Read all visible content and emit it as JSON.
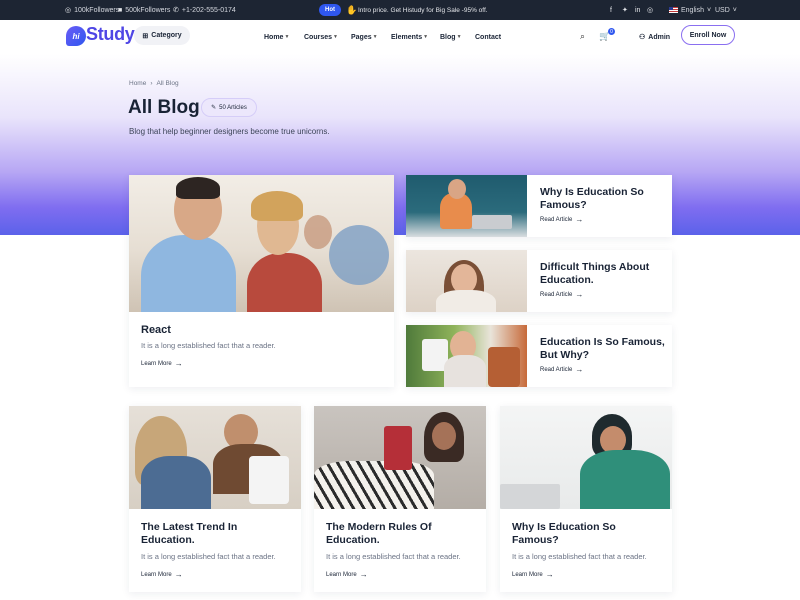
{
  "topbar": {
    "instagram_followers": "100kFollowers",
    "facebook_followers": "500kFollowers",
    "phone": "+1-202-555-0174",
    "hot_badge": "Hot",
    "promo_text": "Intro price. Get Histudy for Big Sale -95% off.",
    "language": "English",
    "currency": "USD"
  },
  "header": {
    "logo_mark": "hi",
    "logo_text": "Study",
    "category_label": "Category",
    "nav": [
      "Home",
      "Courses",
      "Pages",
      "Elements",
      "Blog",
      "Contact"
    ],
    "cart_count": "0",
    "admin_label": "Admin",
    "enroll_label": "Enroll Now"
  },
  "hero": {
    "breadcrumb": [
      "Home",
      "All Blog"
    ],
    "title": "All Blog",
    "articles_badge": "50 Articles",
    "subtitle": "Blog that help beginner designers become true unicorns."
  },
  "featured": {
    "title": "React",
    "excerpt": "It is a long established fact that a reader.",
    "link": "Learn More"
  },
  "side_posts": [
    {
      "title": "Why Is Education So Famous?",
      "link": "Read Article"
    },
    {
      "title": "Difficult Things About Education.",
      "link": "Read Article"
    },
    {
      "title": "Education Is So Famous, But Why?",
      "link": "Read Article"
    }
  ],
  "grid_posts": [
    {
      "title": "The Latest Trend In Education.",
      "excerpt": "It is a long established fact that a reader.",
      "link": "Learn More"
    },
    {
      "title": "The Modern Rules Of Education.",
      "excerpt": "It is a long established fact that a reader.",
      "link": "Learn More"
    },
    {
      "title": "Why Is Education So Famous?",
      "excerpt": "It is a long established fact that a reader.",
      "link": "Learn More"
    }
  ],
  "colors": {
    "primary": "#2f57ef",
    "secondary": "#b966e7",
    "heading": "#192335",
    "body": "#6b7385",
    "topbar": "#1d2533"
  },
  "icons": [
    "instagram-icon",
    "facebook-icon",
    "phone-icon",
    "wave-icon",
    "twitter-icon",
    "linkedin-icon",
    "search-icon",
    "cart-icon",
    "user-icon",
    "grid-icon",
    "arrow-right-icon"
  ]
}
